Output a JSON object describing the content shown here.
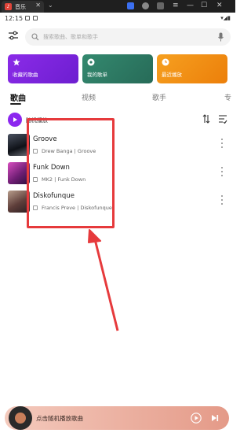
{
  "window": {
    "tab_title": "音乐",
    "tab_close": "✕",
    "tab_chevron": "⌄",
    "menu_label": "≡"
  },
  "status_bar": {
    "time": "12:15",
    "right_text": "▾◢▮"
  },
  "search": {
    "placeholder": "搜索歌曲、歌单和歌手"
  },
  "cards": [
    {
      "label": "收藏的歌曲",
      "color": "#7e22e0",
      "icon": "star-icon"
    },
    {
      "label": "我的歌单",
      "color": "#2f7c67",
      "icon": "disc-icon"
    },
    {
      "label": "最近播放",
      "color": "#f08a10",
      "icon": "clock-icon"
    }
  ],
  "tabs": [
    {
      "label": "歌曲",
      "active": true
    },
    {
      "label": "视频",
      "active": false
    },
    {
      "label": "歌手",
      "active": false
    },
    {
      "label": "专",
      "active": false
    }
  ],
  "play_all": {
    "label": "随机播放"
  },
  "songs": [
    {
      "title": "Groove",
      "subtitle": "Drew Banga | Groove"
    },
    {
      "title": "Funk Down",
      "subtitle": "MK2 | Funk Down"
    },
    {
      "title": "Diskofunque",
      "subtitle": "Francis Preve | Diskofunque"
    }
  ],
  "player": {
    "label": "点击随机播放歌曲"
  },
  "colors": {
    "accent": "#8c27ef",
    "highlight": "#e63a3c"
  }
}
